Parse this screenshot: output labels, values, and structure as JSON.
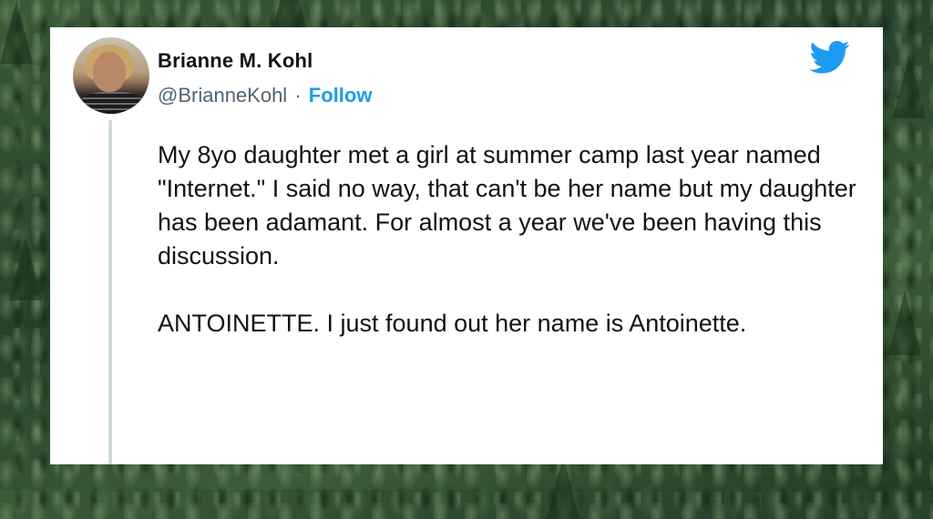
{
  "tweet": {
    "author_name": "Brianne M. Kohl",
    "handle": "@BrianneKohl",
    "separator": "·",
    "follow_label": "Follow",
    "paragraphs": [
      "My 8yo daughter met a girl at summer camp last year named \"Internet.\" I said no way, that can't be her name but my daughter has been adamant. For almost a year we've been having this discussion.",
      "ANTOINETTE. I just found out her name is Antoinette."
    ]
  },
  "icons": {
    "brand": "twitter-bird-icon",
    "avatar": "profile-photo"
  },
  "colors": {
    "accent": "#1d9bf0",
    "text": "#0f1419",
    "secondary_text": "#536471",
    "background": "#2f4a2c",
    "card": "#ffffff"
  }
}
